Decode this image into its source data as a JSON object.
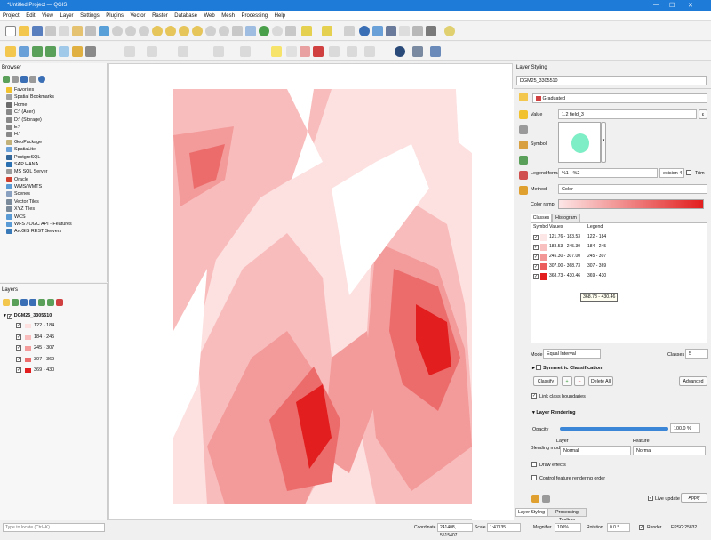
{
  "window": {
    "title": "*Untitled Project — QGIS",
    "minimize": "—",
    "maximize": "☐",
    "close": "✕"
  },
  "menu": [
    "Project",
    "Edit",
    "View",
    "Layer",
    "Settings",
    "Plugins",
    "Vector",
    "Raster",
    "Database",
    "Web",
    "Mesh",
    "Processing",
    "Help"
  ],
  "browser": {
    "title": "Browser",
    "items": [
      {
        "label": "Favorites",
        "color": "#f2c12e"
      },
      {
        "label": "Spatial Bookmarks",
        "color": "#a0a0a0"
      },
      {
        "label": "Home",
        "color": "#6b6b6b"
      },
      {
        "label": "C:\\ (Acer)",
        "color": "#888888"
      },
      {
        "label": "D:\\ (Storage)",
        "color": "#888888"
      },
      {
        "label": "E:\\",
        "color": "#888888"
      },
      {
        "label": "H:\\",
        "color": "#888888"
      },
      {
        "label": "GeoPackage",
        "color": "#c2b27a"
      },
      {
        "label": "SpatiaLite",
        "color": "#6aa0d8"
      },
      {
        "label": "PostgreSQL",
        "color": "#336699"
      },
      {
        "label": "SAP HANA",
        "color": "#2a6fb0"
      },
      {
        "label": "MS SQL Server",
        "color": "#9a9a9a"
      },
      {
        "label": "Oracle",
        "color": "#d04030"
      },
      {
        "label": "WMS/WMTS",
        "color": "#5a9bd5"
      },
      {
        "label": "Scenes",
        "color": "#8aa0c0"
      },
      {
        "label": "Vector Tiles",
        "color": "#7a8a9a"
      },
      {
        "label": "XYZ Tiles",
        "color": "#7a8a9a"
      },
      {
        "label": "WCS",
        "color": "#5a9bd5"
      },
      {
        "label": "WFS / OGC API - Features",
        "color": "#5a9bd5"
      },
      {
        "label": "ArcGIS REST Servers",
        "color": "#3a7ab8"
      }
    ]
  },
  "layers": {
    "title": "Layers",
    "layer_name": "DGM25_3305510",
    "classes": [
      {
        "label": "122 - 184",
        "color": "#fde0e0"
      },
      {
        "label": "184 - 245",
        "color": "#f9bcbc"
      },
      {
        "label": "245 - 307",
        "color": "#f39a9a"
      },
      {
        "label": "307 - 369",
        "color": "#ec6c6c"
      },
      {
        "label": "369 - 430",
        "color": "#e21e1e"
      }
    ]
  },
  "styling": {
    "title": "Layer Styling",
    "layer_select": "DGM25_3305510",
    "renderer": "Graduated",
    "value_label": "Value",
    "value": "1.2 field_3",
    "symbol_label": "Symbol",
    "legend_format_label": "Legend format",
    "legend_format": "%1 - %2",
    "precision": "ecision 4",
    "trim_label": "Trim",
    "method_label": "Method",
    "method": "Color",
    "ramp_label": "Color ramp",
    "tab_classes": "Classes",
    "tab_histogram": "Histogram",
    "col_symbol": "Symbol",
    "col_values": "Values",
    "col_legend": "Legend",
    "rows": [
      {
        "values": "121.76 - 183.53",
        "legend": "122 - 184",
        "color": "#fde6e6"
      },
      {
        "values": "183.53 - 245.30",
        "legend": "184 - 245",
        "color": "#f9c0c0"
      },
      {
        "values": "245.30 - 307.00",
        "legend": "245 - 307",
        "color": "#f39696"
      },
      {
        "values": "307.00 - 368.73",
        "legend": "307 - 369",
        "color": "#ec5e5e"
      },
      {
        "values": "368.73 - 430.46",
        "legend": "369 - 430",
        "color": "#e21e1e"
      }
    ],
    "tooltip": "368.73 - 430.46",
    "mode_label": "Mode",
    "mode": "Equal Interval",
    "classes_label": "Classes",
    "classes_value": "5",
    "symmetric": "Symmetric Classification",
    "classify": "Classify",
    "delete_all": "Delete All",
    "advanced": "Advanced",
    "link_boundaries": "Link class boundaries",
    "layer_rendering": "Layer Rendering",
    "opacity_label": "Opacity",
    "opacity_value": "100.0 %",
    "opacity": 1.0,
    "blending_label": "Blending mode",
    "blend_layer_label": "Layer",
    "blend_feature_label": "Feature",
    "blend_layer": "Normal",
    "blend_feature": "Normal",
    "draw_effects": "Draw effects",
    "control_order": "Control feature rendering order",
    "live_update": "Live update",
    "apply": "Apply",
    "bottom_tab1": "Layer Styling",
    "bottom_tab2": "Processing Toolbox"
  },
  "status": {
    "locate_placeholder": "Type to locate (Ctrl+K)",
    "coordinate_label": "Coordinate",
    "coordinate": "241408, 5515407",
    "scale_label": "Scale",
    "scale": "1:47135",
    "magnifier_label": "Magnifier",
    "magnifier": "100%",
    "rotation_label": "Rotation",
    "rotation": "0.0 °",
    "render_label": "Render",
    "crs": "EPSG:25832"
  },
  "colors": {
    "accent": "#1f7bd8",
    "ramp_start": "#fde6e6",
    "ramp_end": "#e21e1e"
  }
}
